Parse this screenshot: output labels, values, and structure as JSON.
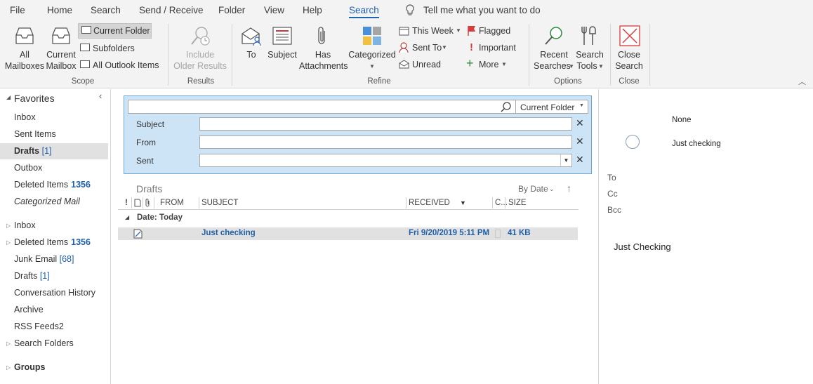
{
  "menu": {
    "tabs": [
      "File",
      "Home",
      "Search",
      "Send / Receive",
      "Folder",
      "View",
      "Help",
      "Search"
    ],
    "active_tab": "Search",
    "tell_me": "Tell me what you want to do"
  },
  "ribbon": {
    "scope": {
      "all_mailboxes": [
        "All",
        "Mailboxes"
      ],
      "current_mailbox": [
        "Current",
        "Mailbox"
      ],
      "current_folder": "Current Folder",
      "subfolders": "Subfolders",
      "all_outlook_items": "All Outlook Items",
      "group_label": "Scope"
    },
    "results": {
      "include_older": [
        "Include",
        "Older Results"
      ],
      "group_label": "Results"
    },
    "refine": {
      "to": "To",
      "subject": "Subject",
      "has_attachments": [
        "Has",
        "Attachments"
      ],
      "categorized": "Categorized",
      "this_week": "This Week",
      "sent_to": "Sent To",
      "unread": "Unread",
      "flagged": "Flagged",
      "important": "Important",
      "more": "More",
      "group_label": "Refine"
    },
    "options": {
      "recent_searches": [
        "Recent",
        "Searches"
      ],
      "search_tools": [
        "Search",
        "Tools"
      ],
      "group_label": "Options"
    },
    "close": {
      "close_search": [
        "Close",
        "Search"
      ],
      "group_label": "Close"
    }
  },
  "nav": {
    "favorites_label": "Favorites",
    "favorites": [
      {
        "label": "Inbox"
      },
      {
        "label": "Sent Items"
      },
      {
        "label": "Drafts",
        "bracket": "[1]"
      },
      {
        "label": "Outbox"
      },
      {
        "label": "Deleted Items",
        "count": "1356"
      },
      {
        "label": "Categorized Mail"
      }
    ],
    "folders": [
      {
        "label": "Inbox"
      },
      {
        "label": "Deleted Items",
        "count": "1356"
      },
      {
        "label": "Junk Email",
        "bracket": "[68]"
      },
      {
        "label": "Drafts",
        "bracket": "[1]"
      },
      {
        "label": "Conversation History"
      },
      {
        "label": "Archive"
      },
      {
        "label": "RSS Feeds2"
      },
      {
        "label": "Search Folders"
      }
    ],
    "groups_label": "Groups"
  },
  "search": {
    "query": "",
    "scope_dropdown": "Current Folder",
    "fields": [
      {
        "label": "Subject",
        "value": ""
      },
      {
        "label": "From",
        "value": ""
      },
      {
        "label": "Sent",
        "value": ""
      }
    ]
  },
  "list": {
    "folder_title": "Drafts",
    "sort_label": "By Date",
    "columns": [
      "!",
      "FROM",
      "SUBJECT",
      "RECEIVED",
      "C...",
      "SIZE"
    ],
    "group_header": "Date: Today",
    "rows": [
      {
        "from": "",
        "subject": "Just checking",
        "received": "Fri 9/20/2019 5:11 PM",
        "size": "41 KB"
      }
    ]
  },
  "reading": {
    "importance": "None",
    "subject": "Just checking",
    "to_label": "To",
    "cc_label": "Cc",
    "bcc_label": "Bcc",
    "body": "Just Checking"
  },
  "colors": {
    "accent": "#1e62b0",
    "search_panel": "#cde4f7",
    "selected_row": "#e1e1e1"
  }
}
